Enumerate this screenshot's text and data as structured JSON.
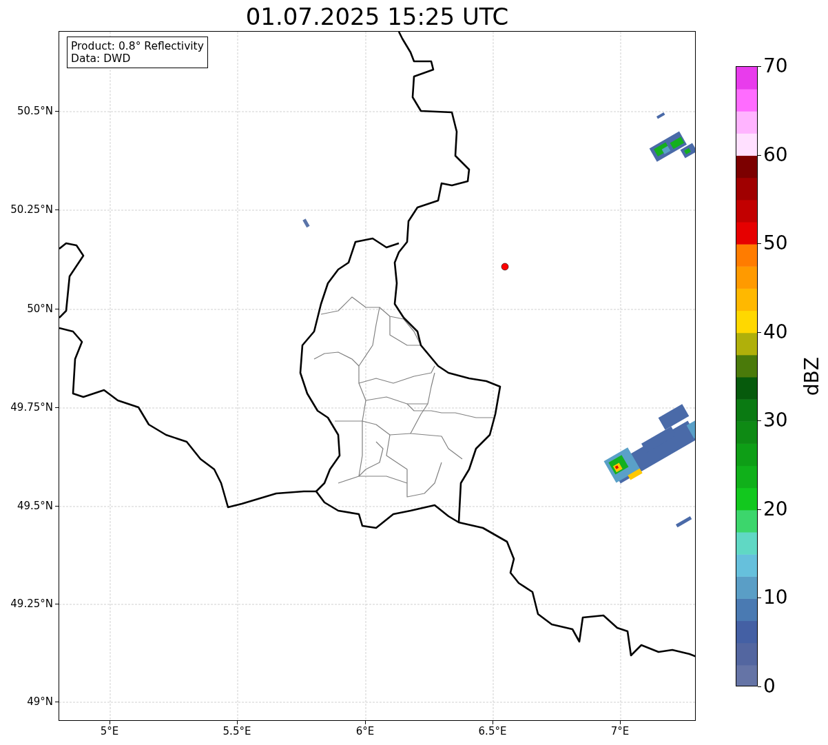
{
  "title": "01.07.2025 15:25 UTC",
  "info_box": {
    "lines": [
      "Product: 0.8° Reflectivity",
      "Data: DWD"
    ]
  },
  "map": {
    "y_ticks": [
      "50.5°N",
      "50.25°N",
      "50°N",
      "49.75°N",
      "49.5°N",
      "49.25°N",
      "49°N"
    ],
    "x_ticks": [
      "5°E",
      "5.5°E",
      "6°E",
      "6.5°E",
      "7°E"
    ]
  },
  "colorbar": {
    "label": "dBZ",
    "ticks": [
      "70",
      "60",
      "50",
      "40",
      "30",
      "20",
      "10",
      "0"
    ],
    "bands": [
      {
        "color": "#6574a6"
      },
      {
        "color": "#5366a0"
      },
      {
        "color": "#4460a4"
      },
      {
        "color": "#4a7ab2"
      },
      {
        "color": "#5a9ec6"
      },
      {
        "color": "#66c0dc"
      },
      {
        "color": "#60d8c4"
      },
      {
        "color": "#3cd66c"
      },
      {
        "color": "#12c81e"
      },
      {
        "color": "#10b01a"
      },
      {
        "color": "#0e9e16"
      },
      {
        "color": "#0e8a14"
      },
      {
        "color": "#0a7a12"
      },
      {
        "color": "#065a0c"
      },
      {
        "color": "#4a7a0a"
      },
      {
        "color": "#b0b00a"
      },
      {
        "color": "#ffd800"
      },
      {
        "color": "#ffb800"
      },
      {
        "color": "#ff9a00"
      },
      {
        "color": "#ff7c00"
      },
      {
        "color": "#e60000"
      },
      {
        "color": "#c20000"
      },
      {
        "color": "#a00000"
      },
      {
        "color": "#7c0000"
      },
      {
        "color": "#ffe0ff"
      },
      {
        "color": "#ffb4ff"
      },
      {
        "color": "#ff6cff"
      },
      {
        "color": "#e83cec"
      }
    ]
  }
}
